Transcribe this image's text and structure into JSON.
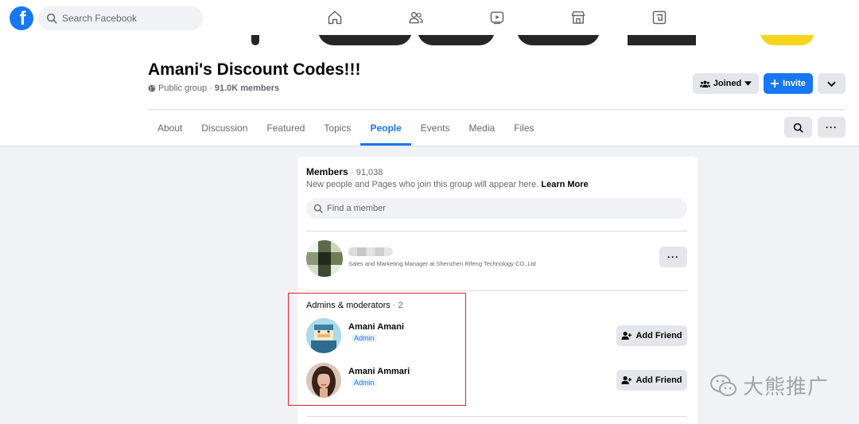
{
  "topbar": {
    "search_placeholder": "Search Facebook",
    "nav_icons": [
      "home-icon",
      "friends-icon",
      "watch-icon",
      "marketplace-icon",
      "gaming-icon"
    ]
  },
  "group": {
    "title": "Amani's Discount Codes!!!",
    "privacy": "Public group",
    "members_short": "91.0K members",
    "joined_label": "Joined",
    "invite_label": "Invite"
  },
  "tabs": [
    "About",
    "Discussion",
    "Featured",
    "Topics",
    "People",
    "Events",
    "Media",
    "Files"
  ],
  "active_tab": "People",
  "members": {
    "title": "Members",
    "count": "· 91,038",
    "desc": "New people and Pages who join this group will appear here.",
    "learn_more": "Learn More",
    "find_placeholder": "Find a member"
  },
  "current_user": {
    "subtitle": "Sales and Marketing Manager at Shenzhen Rifeng Technology CO.,Ltd"
  },
  "admins": {
    "title": "Admins & moderators",
    "count": "· 2",
    "people": [
      {
        "name": "Amani Amani",
        "role": "Admin",
        "action": "Add Friend"
      },
      {
        "name": "Amani Ammari",
        "role": "Admin",
        "action": "Add Friend"
      }
    ]
  },
  "watermark": {
    "text": "大熊推广"
  },
  "colors": {
    "accent": "#1877f2",
    "highlight": "#e0262f"
  }
}
